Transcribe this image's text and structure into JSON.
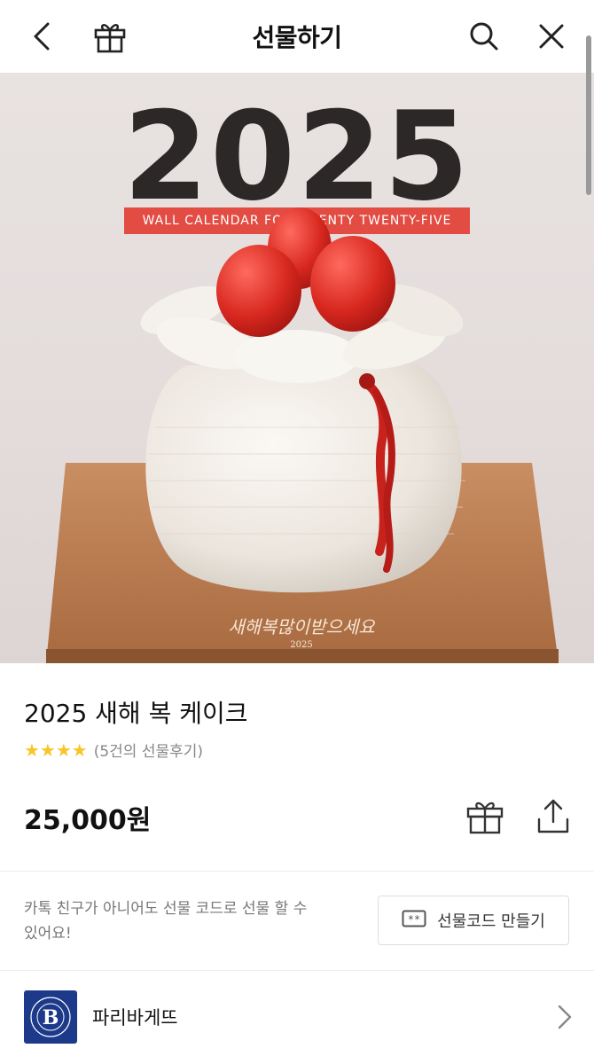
{
  "header": {
    "title": "선물하기"
  },
  "hero": {
    "year_text": "2025",
    "banner_text": "WALL CALENDAR FOR TWENTY TWENTY-FIVE",
    "board_text": "새해복많이받으세요",
    "board_year": "2025"
  },
  "product": {
    "title": "2025 새해 복 케이크",
    "stars": "★★★★",
    "review_text": "(5건의 선물후기)",
    "price": "25,000원"
  },
  "promo": {
    "text": "카톡 친구가 아니어도 선물 코드로 선물 할 수 있어요!",
    "code_button_label": "선물코드 만들기"
  },
  "brand": {
    "name": "파리바게뜨",
    "logo_letter": "B",
    "logo_ring_text": "PARIS BAGUETTE · BOULANGERIE"
  },
  "colors": {
    "star": "#f6c62a",
    "banner": "#e24c43",
    "brand_logo": "#1d3a8a"
  }
}
